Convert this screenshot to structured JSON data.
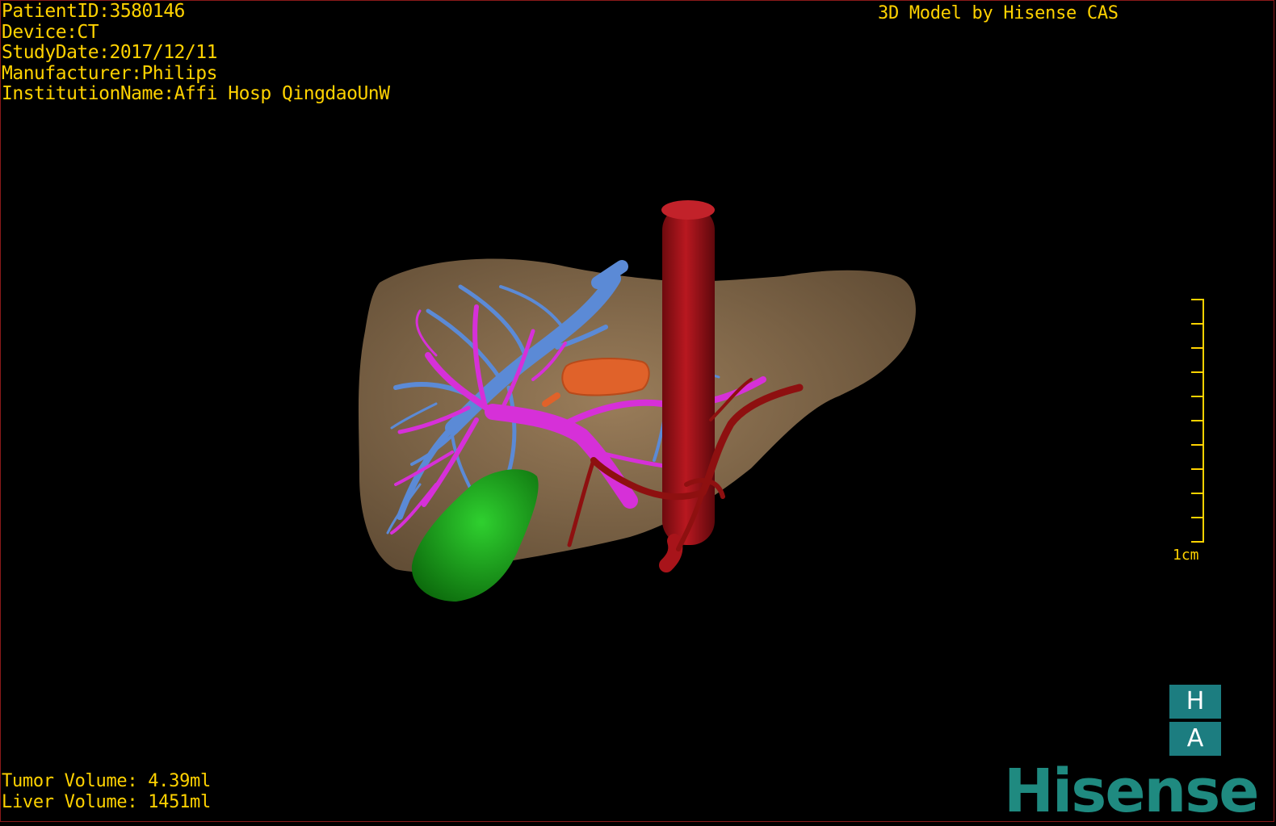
{
  "header": {
    "lines": [
      "PatientID:3580146",
      "Device:CT",
      "StudyDate:2017/12/11",
      "Manufacturer:Philips",
      "InstitutionName:Affi Hosp QingdaoUnW"
    ],
    "title": "3D Model by Hisense CAS"
  },
  "footer": {
    "tumor_volume": "Tumor Volume: 4.39ml",
    "liver_volume": "Liver Volume: 1451ml"
  },
  "scale": {
    "label": "1cm"
  },
  "orientation": {
    "top": "H",
    "bottom": "A"
  },
  "logo": {
    "text": "Hisense"
  },
  "colors": {
    "text": "#ffd200",
    "liver": "#8a6e4e",
    "hepatic_vein": "#5b8ad6",
    "portal_vein": "#d630d8",
    "vena_cava": "#a8141a",
    "artery": "#8e1010",
    "tumor": "#e0622a",
    "gallbladder": "#1aa01a",
    "brand": "#1f8a80"
  }
}
